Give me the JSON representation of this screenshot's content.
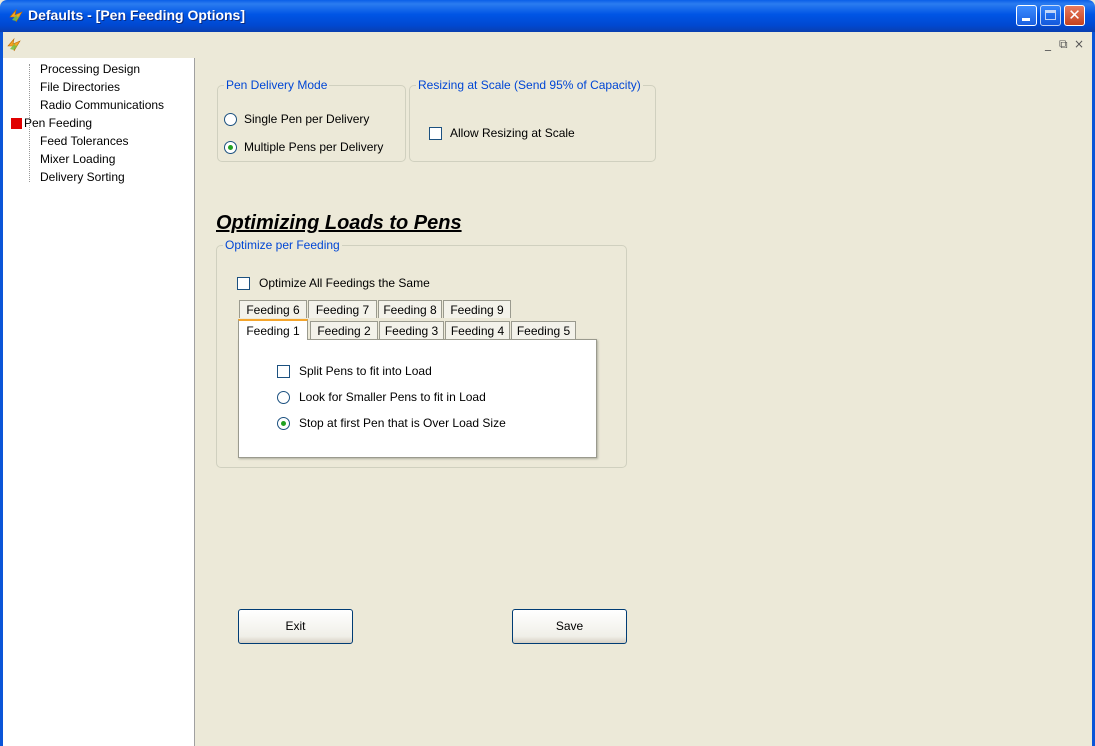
{
  "window": {
    "title": "Defaults - [Pen Feeding Options]",
    "mdi_controls": [
      "_",
      "⧉",
      "×"
    ]
  },
  "nav": {
    "items": [
      {
        "label": "Processing Design",
        "selected": false
      },
      {
        "label": "File Directories",
        "selected": false
      },
      {
        "label": "Radio Communications",
        "selected": false
      },
      {
        "label": "Pen Feeding",
        "selected": true
      },
      {
        "label": "Feed Tolerances",
        "selected": false
      },
      {
        "label": "Mixer Loading",
        "selected": false
      },
      {
        "label": "Delivery Sorting",
        "selected": false
      }
    ]
  },
  "pen_delivery_mode": {
    "legend": "Pen Delivery Mode",
    "options": [
      {
        "label": "Single Pen per Delivery",
        "checked": false
      },
      {
        "label": "Multiple Pens per Delivery",
        "checked": true
      }
    ]
  },
  "resizing": {
    "legend": "Resizing at Scale (Send 95% of Capacity)",
    "allow_label": "Allow Resizing at Scale",
    "checked": false
  },
  "optimizing": {
    "heading": "Optimizing Loads to Pens",
    "legend": "Optimize per Feeding",
    "optimize_all_label": "Optimize All Feedings the Same",
    "optimize_all_checked": false,
    "tabs_back": [
      "Feeding 6",
      "Feeding 7",
      "Feeding 8",
      "Feeding 9"
    ],
    "tabs_front": [
      "Feeding 1",
      "Feeding 2",
      "Feeding 3",
      "Feeding 4",
      "Feeding 5"
    ],
    "active_tab": "Feeding 1",
    "panel": {
      "split_label": "Split Pens to fit into Load",
      "split_checked": false,
      "look_smaller_label": "Look for Smaller Pens to fit in Load",
      "look_smaller_checked": false,
      "stop_first_label": "Stop at first Pen that is Over Load Size",
      "stop_first_checked": true
    }
  },
  "buttons": {
    "exit": "Exit",
    "save": "Save"
  },
  "colors": {
    "titlebar": "#0055e5",
    "legend_text": "#0046d5",
    "selected_marker": "#e00000",
    "active_tab_accent": "#f4a52c"
  }
}
